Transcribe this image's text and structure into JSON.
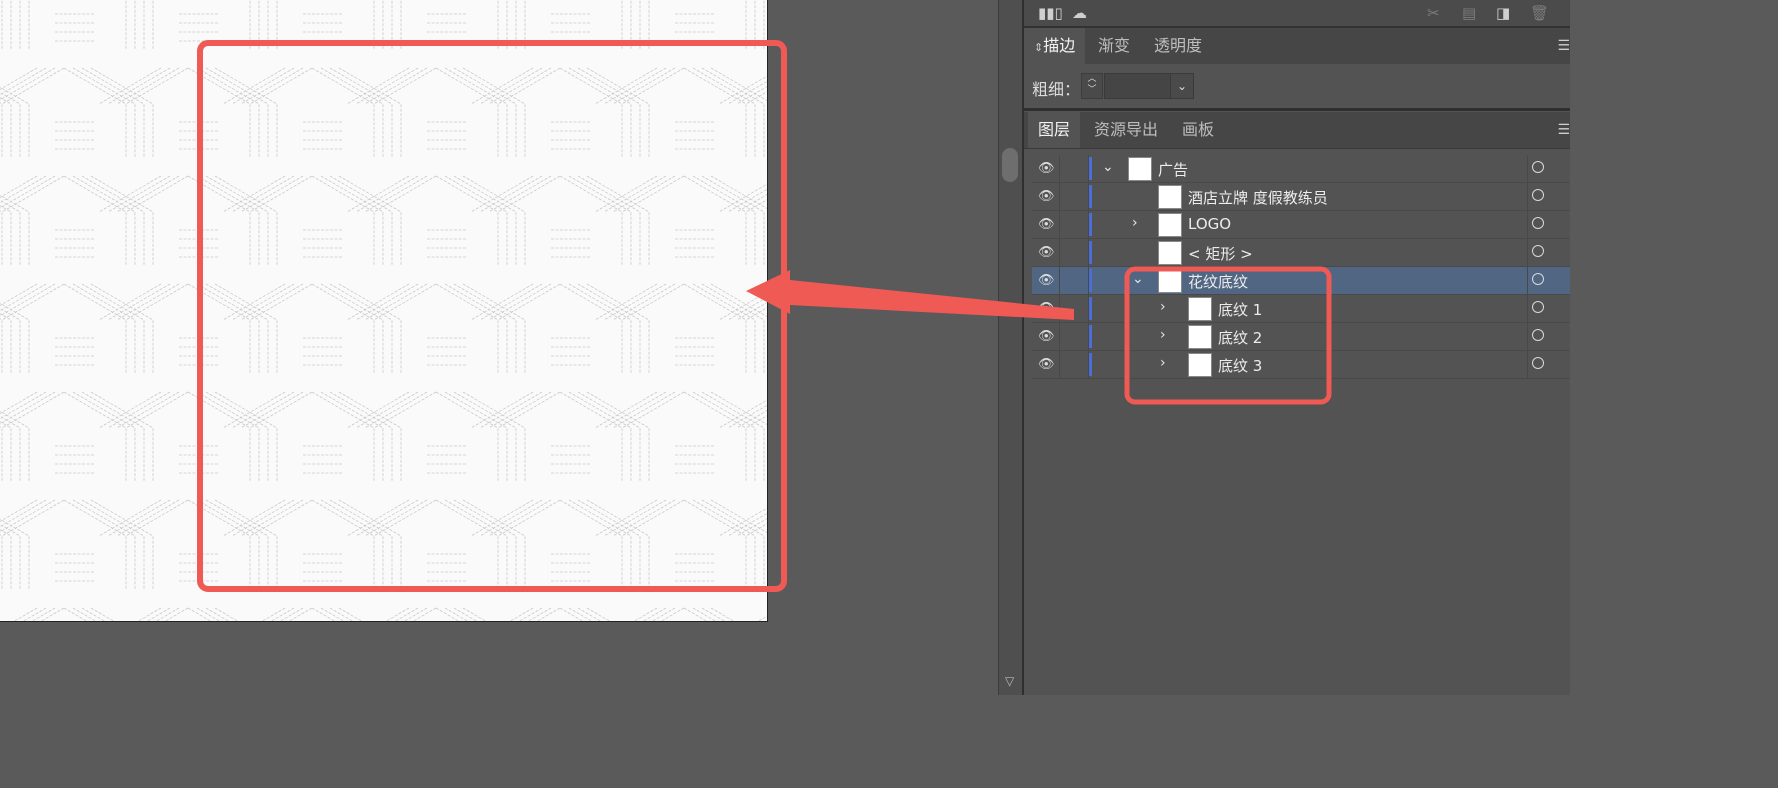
{
  "toolbar": {
    "icons": [
      "libraries-icon",
      "creative-cloud-icon",
      "scissors-icon",
      "new-layer-icon",
      "move-layer-icon",
      "trash-icon"
    ]
  },
  "stroke_panel": {
    "tabs": [
      {
        "label": "描边",
        "active": true
      },
      {
        "label": "渐变",
        "active": false
      },
      {
        "label": "透明度",
        "active": false
      }
    ],
    "weight_label": "粗细：",
    "weight_value": ""
  },
  "layers_panel": {
    "tabs": [
      {
        "label": "图层",
        "active": true
      },
      {
        "label": "资源导出",
        "active": false
      },
      {
        "label": "画板",
        "active": false
      }
    ],
    "layers": [
      {
        "name": "广告",
        "expanded": true,
        "level": 0
      },
      {
        "name": "酒店立牌 度假教练员",
        "level": 1
      },
      {
        "name": "LOGO",
        "level": 1,
        "collapsed": true
      },
      {
        "name": "< 矩形 >",
        "level": 1
      },
      {
        "name": "花纹底纹",
        "level": 1,
        "expanded": true,
        "selected": true
      },
      {
        "name": "底纹 1",
        "level": 2,
        "collapsed": true
      },
      {
        "name": "底纹 2",
        "level": 2,
        "collapsed": true
      },
      {
        "name": "底纹 3",
        "level": 2,
        "collapsed": true
      }
    ]
  },
  "annotation": {
    "color": "#ef5a55"
  },
  "colors": {
    "layer_color": "#4a6dd6",
    "selected_row": "#506683",
    "panel_bg": "#535353"
  }
}
